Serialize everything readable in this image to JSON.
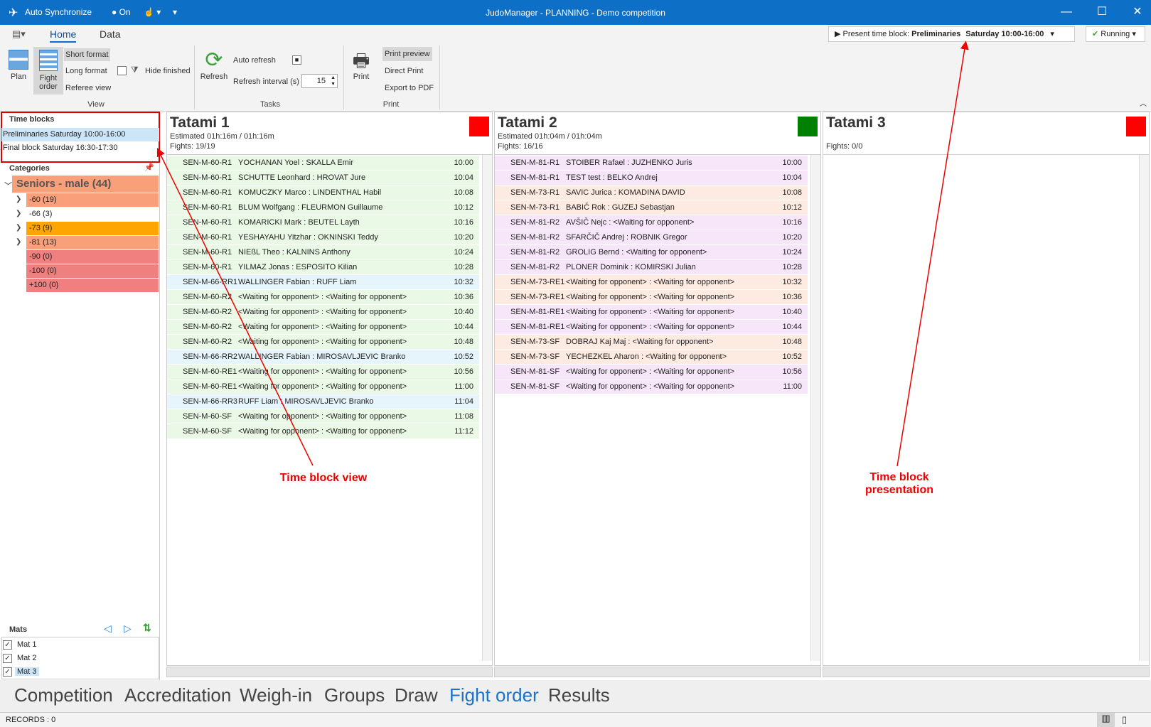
{
  "titlebar": {
    "sync_label": "Auto Synchronize",
    "sync_state": "On",
    "title": "JudoManager - PLANNING - Demo competition"
  },
  "ribbon": {
    "tabs": [
      "Home",
      "Data"
    ],
    "present_prefix": "Present time block:",
    "present_name": "Preliminaries",
    "present_time": "Saturday 10:00-16:00",
    "running": "Running",
    "plan": "Plan",
    "fight_order_1": "Fight",
    "fight_order_2": "order",
    "short_format": "Short format",
    "long_format": "Long format",
    "referee_view": "Referee view",
    "hide_finished": "Hide finished",
    "view_group": "View",
    "refresh": "Refresh",
    "auto_refresh": "Auto refresh",
    "refresh_interval": "Refresh interval (s)",
    "interval_value": "15",
    "tasks_group": "Tasks",
    "print": "Print",
    "print_preview": "Print preview",
    "direct_print": "Direct Print",
    "export_pdf": "Export to PDF",
    "print_group": "Print"
  },
  "left": {
    "timeblocks_header": "Time blocks",
    "timeblocks": [
      "Preliminaries  Saturday 10:00-16:00",
      "Final block  Saturday 16:30-17:30"
    ],
    "categories_header": "Categories",
    "group": "Seniors - male (44)",
    "categories": [
      "-60 (19)",
      "-66 (3)",
      "-73 (9)",
      "-81 (13)",
      "-90 (0)",
      "-100 (0)",
      "+100 (0)"
    ],
    "mats_header": "Mats",
    "mats": [
      "Mat 1",
      "Mat 2",
      "Mat 3"
    ]
  },
  "tatamis": [
    {
      "title": "Tatami 1",
      "estimated": "Estimated 01h:16m / 01h:16m",
      "fights": "Fights: 19/19",
      "flag": "#ff0000"
    },
    {
      "title": "Tatami 2",
      "estimated": "Estimated 01h:04m / 01h:04m",
      "fights": "Fights: 16/16",
      "flag": "#008000"
    },
    {
      "title": "Tatami 3",
      "estimated": "",
      "fights": "Fights: 0/0",
      "flag": "#ff0000"
    }
  ],
  "fights1": [
    [
      "SEN-M-60-R1",
      "YOCHANAN Yoel : SKALLA Emir",
      "10:00",
      "g"
    ],
    [
      "SEN-M-60-R1",
      "SCHUTTE Leonhard : HROVAT Jure",
      "10:04",
      "g"
    ],
    [
      "SEN-M-60-R1",
      "KOMUCZKY Marco : LINDENTHAL Habil",
      "10:08",
      "g"
    ],
    [
      "SEN-M-60-R1",
      "BLUM Wolfgang : FLEURMON Guillaume",
      "10:12",
      "g"
    ],
    [
      "SEN-M-60-R1",
      "KOMARICKI Mark : BEUTEL Layth",
      "10:16",
      "g"
    ],
    [
      "SEN-M-60-R1",
      "YESHAYAHU Yitzhar : OKNINSKI Teddy",
      "10:20",
      "g"
    ],
    [
      "SEN-M-60-R1",
      "NIEßL Theo : KALNINS Anthony",
      "10:24",
      "g"
    ],
    [
      "SEN-M-60-R1",
      "YILMAZ Jonas : ESPOSITO Kilian",
      "10:28",
      "g"
    ],
    [
      "SEN-M-66-RR1",
      "WALLINGER Fabian : RUFF Liam",
      "10:32",
      "b"
    ],
    [
      "SEN-M-60-R2",
      "<Waiting for opponent> : <Waiting for opponent>",
      "10:36",
      "g"
    ],
    [
      "SEN-M-60-R2",
      "<Waiting for opponent> : <Waiting for opponent>",
      "10:40",
      "g"
    ],
    [
      "SEN-M-60-R2",
      "<Waiting for opponent> : <Waiting for opponent>",
      "10:44",
      "g"
    ],
    [
      "SEN-M-60-R2",
      "<Waiting for opponent> : <Waiting for opponent>",
      "10:48",
      "g"
    ],
    [
      "SEN-M-66-RR2",
      "WALLINGER Fabian : MIROSAVLJEVIC Branko",
      "10:52",
      "b"
    ],
    [
      "SEN-M-60-RE1",
      "<Waiting for opponent> : <Waiting for opponent>",
      "10:56",
      "g"
    ],
    [
      "SEN-M-60-RE1",
      "<Waiting for opponent> : <Waiting for opponent>",
      "11:00",
      "g"
    ],
    [
      "SEN-M-66-RR3",
      "RUFF Liam : MIROSAVLJEVIC Branko",
      "11:04",
      "b"
    ],
    [
      "SEN-M-60-SF",
      "<Waiting for opponent> : <Waiting for opponent>",
      "11:08",
      "g"
    ],
    [
      "SEN-M-60-SF",
      "<Waiting for opponent> : <Waiting for opponent>",
      "11:12",
      "g"
    ]
  ],
  "fights2": [
    [
      "SEN-M-81-R1",
      "STOIBER Rafael : JUZHENKO Juris",
      "10:00",
      "p"
    ],
    [
      "SEN-M-81-R1",
      "TEST test : BELKO Andrej",
      "10:04",
      "p"
    ],
    [
      "SEN-M-73-R1",
      "SAVIC Jurica : KOMADINA DAVID",
      "10:08",
      "o"
    ],
    [
      "SEN-M-73-R1",
      "BABIČ Rok : GUZEJ Sebastjan",
      "10:12",
      "o"
    ],
    [
      "SEN-M-81-R2",
      "AVŠIČ Nejc : <Waiting for opponent>",
      "10:16",
      "p"
    ],
    [
      "SEN-M-81-R2",
      "SFARČIČ Andrej : ROBNIK Gregor",
      "10:20",
      "p"
    ],
    [
      "SEN-M-81-R2",
      "GROLIG Bernd : <Waiting for opponent>",
      "10:24",
      "p"
    ],
    [
      "SEN-M-81-R2",
      "PLONER Dominik : KOMIRSKI Julian",
      "10:28",
      "p"
    ],
    [
      "SEN-M-73-RE1",
      "<Waiting for opponent> : <Waiting for opponent>",
      "10:32",
      "o"
    ],
    [
      "SEN-M-73-RE1",
      "<Waiting for opponent> : <Waiting for opponent>",
      "10:36",
      "o"
    ],
    [
      "SEN-M-81-RE1",
      "<Waiting for opponent> : <Waiting for opponent>",
      "10:40",
      "p"
    ],
    [
      "SEN-M-81-RE1",
      "<Waiting for opponent> : <Waiting for opponent>",
      "10:44",
      "p"
    ],
    [
      "SEN-M-73-SF",
      "DOBRAJ Kaj Maj : <Waiting for opponent>",
      "10:48",
      "o"
    ],
    [
      "SEN-M-73-SF",
      "YECHEZKEL Aharon : <Waiting for opponent>",
      "10:52",
      "o"
    ],
    [
      "SEN-M-81-SF",
      "<Waiting for opponent> : <Waiting for opponent>",
      "10:56",
      "p"
    ],
    [
      "SEN-M-81-SF",
      "<Waiting for opponent> : <Waiting for opponent>",
      "11:00",
      "p"
    ]
  ],
  "row_colors": {
    "g": "#eaf9e6",
    "b": "#e6f5fb",
    "p": "#f7e6fa",
    "o": "#fdebe1"
  },
  "category_colors": [
    "#f9a07a",
    "#ffffff",
    "#ffa500",
    "#f9a07a",
    "#f08080",
    "#f08080",
    "#f08080"
  ],
  "nav": [
    "Competition",
    "Accreditation",
    "Weigh-in",
    "Groups",
    "Draw",
    "Fight order",
    "Results"
  ],
  "status": "RECORDS : 0",
  "annotations": {
    "left": "Time block view",
    "right_1": "Time block",
    "right_2": "presentation"
  }
}
